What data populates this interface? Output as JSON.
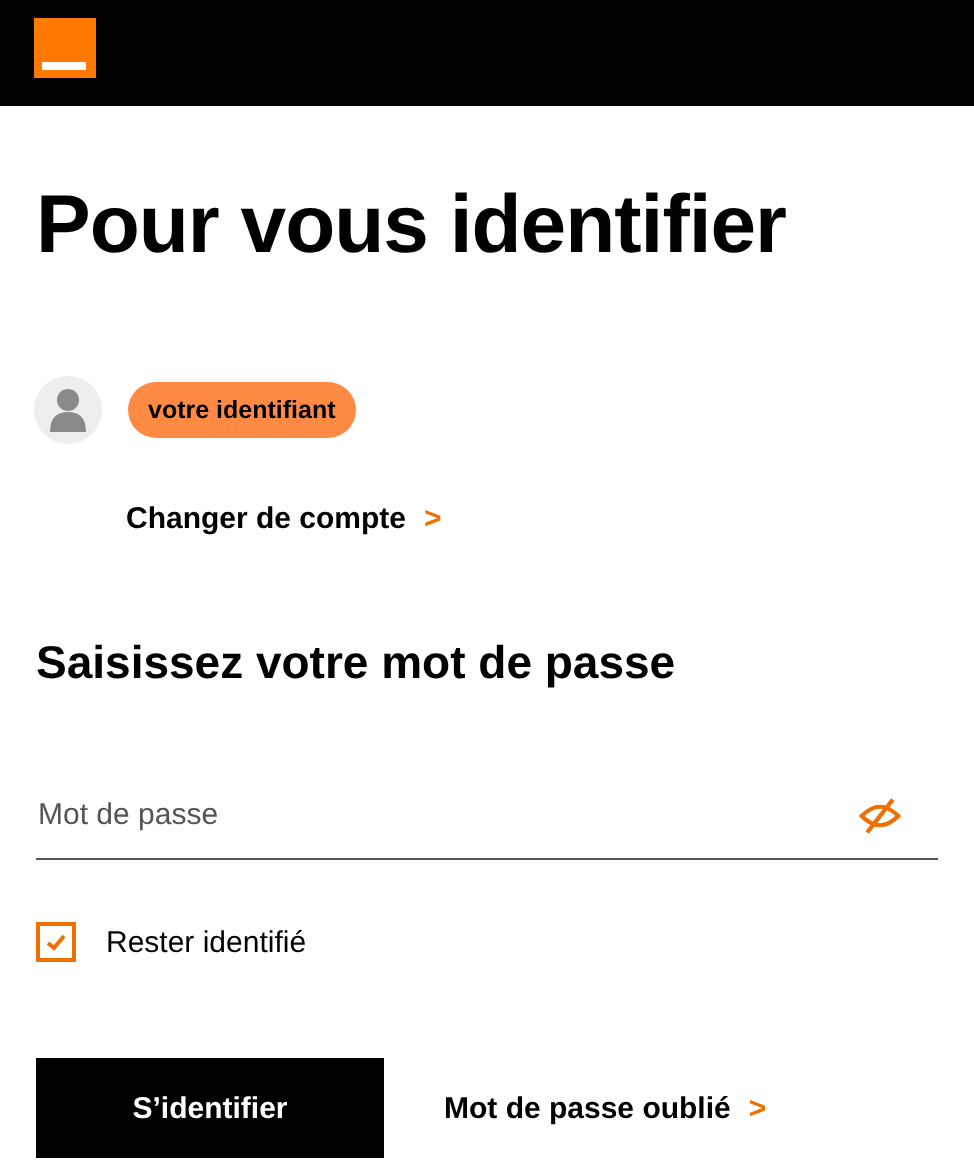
{
  "title": "Pour vous identifier",
  "account": {
    "identifier": "votre identifiant",
    "change_link": "Changer de compte",
    "change_arrow": ">"
  },
  "password_section": {
    "heading": "Saisissez votre mot de passe",
    "field": {
      "placeholder": "Mot de passe",
      "visible": false
    }
  },
  "remember": {
    "label": "Rester identifié",
    "checked": true
  },
  "submit": "S’identifier",
  "forgot_link": "Mot de passe oublié",
  "forgot_arrow": ">"
}
